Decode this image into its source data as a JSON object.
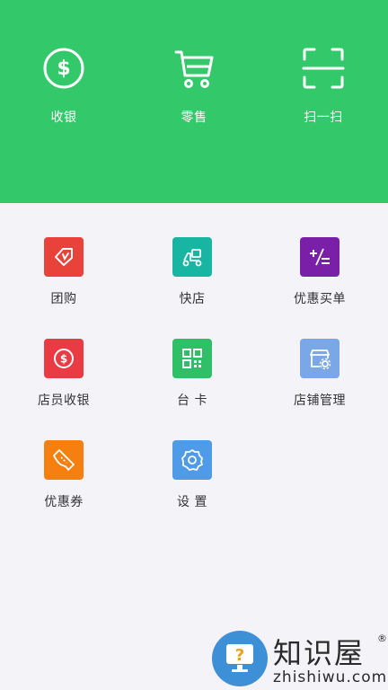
{
  "header": {
    "background_color": "#33c86a",
    "actions": [
      {
        "label": "收银",
        "icon": "dollar-circle-icon"
      },
      {
        "label": "零售",
        "icon": "cart-icon"
      },
      {
        "label": "扫一扫",
        "icon": "scan-icon"
      }
    ]
  },
  "grid": {
    "items": [
      {
        "label": "团购",
        "icon": "tag-icon",
        "color": "#e8423a"
      },
      {
        "label": "快店",
        "icon": "scooter-icon",
        "color": "#19b5a3"
      },
      {
        "label": "优惠买单",
        "icon": "plus-minus-icon",
        "color": "#7a1fa8"
      },
      {
        "label": "店员收银",
        "icon": "dollar-circle-icon",
        "color": "#ea3b44"
      },
      {
        "label": "台 卡",
        "icon": "qr-code-icon",
        "color": "#2fbf66"
      },
      {
        "label": "店铺管理",
        "icon": "store-settings-icon",
        "color": "#7aa8e6"
      },
      {
        "label": "优惠券",
        "icon": "ticket-icon",
        "color": "#f5800f"
      },
      {
        "label": "设 置",
        "icon": "gear-icon",
        "color": "#4f9be8"
      }
    ]
  },
  "watermark": {
    "title": "知识屋",
    "url": "zhishiwu.com",
    "registered": "®"
  }
}
